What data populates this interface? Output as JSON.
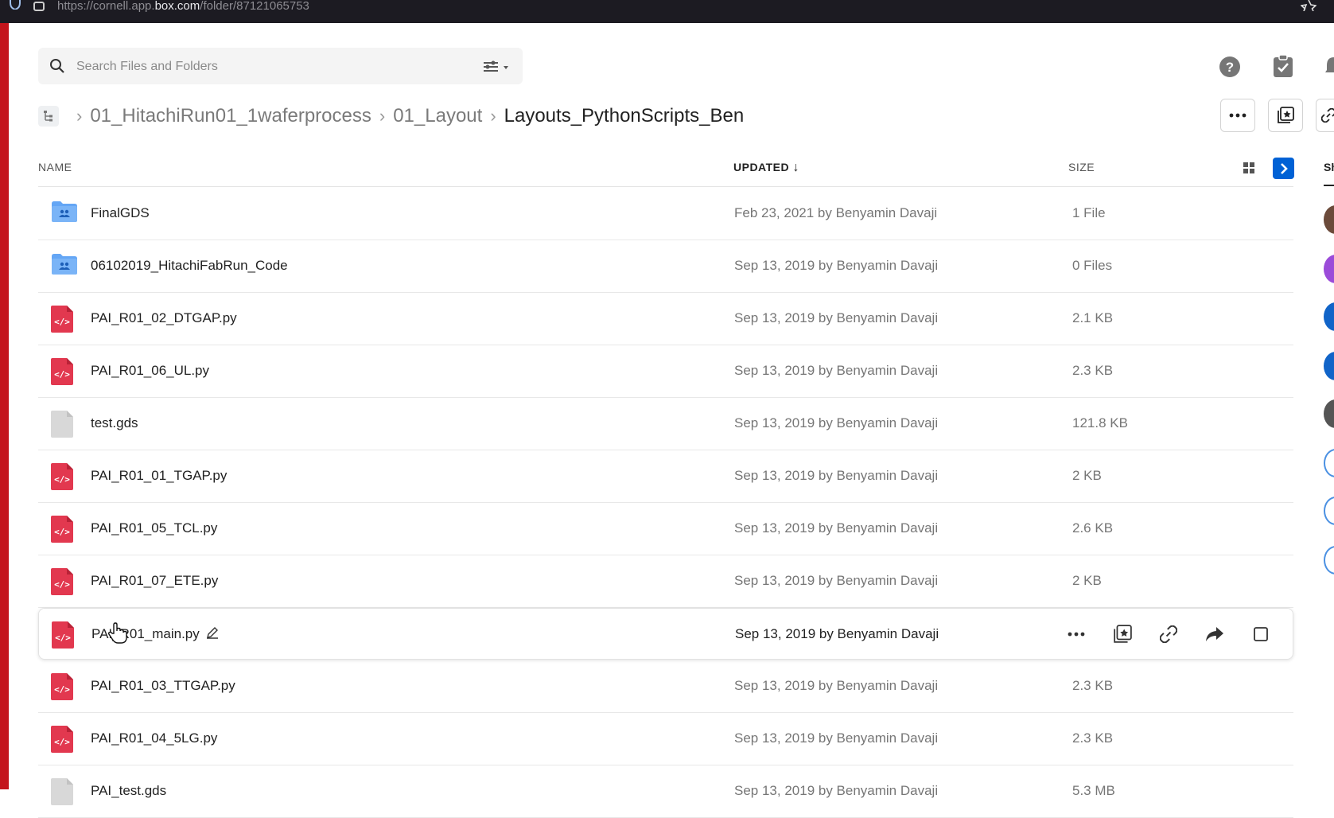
{
  "browser": {
    "url_prefix": "https://cornell.app.",
    "url_domain": "box.com",
    "url_path": "/folder/87121065753"
  },
  "search": {
    "placeholder": "Search Files and Folders",
    "value": ""
  },
  "breadcrumb": {
    "items": [
      "01_HitachiRun01_1waferprocess",
      "01_Layout"
    ],
    "current": "Layouts_PythonScripts_Ben"
  },
  "columns": {
    "name": "NAME",
    "updated": "UPDATED",
    "size": "SIZE"
  },
  "sidebar": {
    "tab_label": "Sh"
  },
  "files": [
    {
      "name": "FinalGDS",
      "type": "folder",
      "updated": "Feb 23, 2021 by Benyamin Davaji",
      "size": "1 File"
    },
    {
      "name": "06102019_HitachiFabRun_Code",
      "type": "folder",
      "updated": "Sep 13, 2019 by Benyamin Davaji",
      "size": "0 Files"
    },
    {
      "name": "PAI_R01_02_DTGAP.py",
      "type": "code",
      "updated": "Sep 13, 2019 by Benyamin Davaji",
      "size": "2.1 KB"
    },
    {
      "name": "PAI_R01_06_UL.py",
      "type": "code",
      "updated": "Sep 13, 2019 by Benyamin Davaji",
      "size": "2.3 KB"
    },
    {
      "name": "test.gds",
      "type": "generic",
      "updated": "Sep 13, 2019 by Benyamin Davaji",
      "size": "121.8 KB"
    },
    {
      "name": "PAI_R01_01_TGAP.py",
      "type": "code",
      "updated": "Sep 13, 2019 by Benyamin Davaji",
      "size": "2 KB"
    },
    {
      "name": "PAI_R01_05_TCL.py",
      "type": "code",
      "updated": "Sep 13, 2019 by Benyamin Davaji",
      "size": "2.6 KB"
    },
    {
      "name": "PAI_R01_07_ETE.py",
      "type": "code",
      "updated": "Sep 13, 2019 by Benyamin Davaji",
      "size": "2 KB"
    },
    {
      "name": "PAI_R01_main.py",
      "type": "code",
      "updated": "Sep 13, 2019 by Benyamin Davaji",
      "size": "",
      "hover": true
    },
    {
      "name": "PAI_R01_03_TTGAP.py",
      "type": "code",
      "updated": "Sep 13, 2019 by Benyamin Davaji",
      "size": "2.3 KB"
    },
    {
      "name": "PAI_R01_04_5LG.py",
      "type": "code",
      "updated": "Sep 13, 2019 by Benyamin Davaji",
      "size": "2.3 KB"
    },
    {
      "name": "PAI_test.gds",
      "type": "generic",
      "updated": "Sep 13, 2019 by Benyamin Davaji",
      "size": "5.3 MB"
    }
  ],
  "colors": {
    "accent": "#0061d5",
    "code_file": "#e2384f",
    "folder": "#64a6f5",
    "red_border": "#c4151c"
  }
}
